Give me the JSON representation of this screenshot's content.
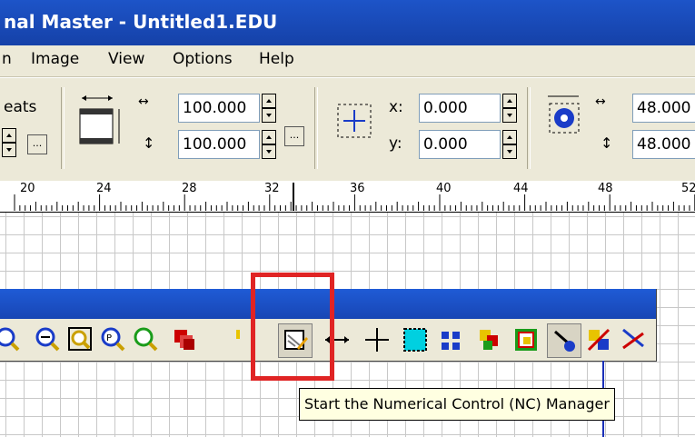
{
  "window": {
    "title": "nal Master - Untitled1.EDU"
  },
  "menu": [
    {
      "label": "n"
    },
    {
      "label": "Image"
    },
    {
      "label": "View"
    },
    {
      "label": "Options"
    },
    {
      "label": "Help"
    }
  ],
  "toolbar": {
    "repeats_label": "eats",
    "width_value": "100.000",
    "height_value": "100.000",
    "x_label": "x:",
    "x_value": "0.000",
    "y_label": "y:",
    "y_value": "0.000",
    "hw_value": "48.000",
    "hh_value": "48.000",
    "ellipsis": "..."
  },
  "ruler": {
    "labels": [
      "20",
      "24",
      "28",
      "32",
      "36",
      "40",
      "44",
      "48",
      "52"
    ]
  },
  "float_toolbar": {
    "icons": [
      "zoom-icon",
      "zoom-out-icon",
      "zoom-extents-icon",
      "zoom-previous-icon",
      "zoom-selection-icon",
      "layers-icon",
      "nc-manager-icon",
      "move-horizontal-icon",
      "move-icon",
      "select-area-icon",
      "dots-icon",
      "group-icon",
      "ungroup-icon",
      "view-icon",
      "color-swap-icon",
      "cut-icon"
    ]
  },
  "tooltip": {
    "text": "Start the Numerical Control (NC) Manager"
  },
  "colors": {
    "titlebar": "#1d54c8",
    "highlight": "#e02424",
    "tooltip_bg": "#ffffe1"
  }
}
